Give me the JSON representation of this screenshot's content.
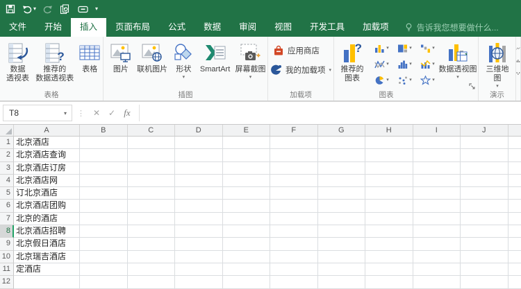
{
  "ui": {
    "caret": "▾",
    "dots": "⋮",
    "question_mark": "?"
  },
  "colors": {
    "brand_green": "#217346",
    "accent_green": "#21a366",
    "icon_blue": "#4472c4",
    "icon_dark_blue": "#2b579a",
    "icon_yellow": "#ffc000",
    "store_red": "#d24726",
    "ribbon_bg": "#f9fafa",
    "gridline": "#dadde0"
  },
  "quick_access": {
    "icons": [
      "save-icon",
      "undo-icon",
      "redo-icon",
      "document-refresh-icon",
      "touch-mode-icon",
      "customize-qat-caret-icon"
    ]
  },
  "tabs": [
    {
      "label": "文件",
      "active": false
    },
    {
      "label": "开始",
      "active": false
    },
    {
      "label": "插入",
      "active": true
    },
    {
      "label": "页面布局",
      "active": false
    },
    {
      "label": "公式",
      "active": false
    },
    {
      "label": "数据",
      "active": false
    },
    {
      "label": "审阅",
      "active": false
    },
    {
      "label": "视图",
      "active": false
    },
    {
      "label": "开发工具",
      "active": false
    },
    {
      "label": "加载项",
      "active": false
    }
  ],
  "tellme": {
    "label": "告诉我您想要做什么..."
  },
  "ribbon": {
    "group_tables": {
      "label": "表格",
      "pivot": "数据\n透视表",
      "recommended_pivot": "推荐的\n数据透视表",
      "table": "表格"
    },
    "group_illustrations": {
      "label": "插图",
      "pictures": "图片",
      "online_pictures": "联机图片",
      "shapes": "形状",
      "smartart": "SmartArt",
      "screenshot": "屏幕截图"
    },
    "group_addins": {
      "label": "加载项",
      "store": "应用商店",
      "my_addins": "我的加载项"
    },
    "group_charts": {
      "label": "图表",
      "recommended": "推荐的\n图表",
      "pivotchart": "数据透视图",
      "chart_type_icons": [
        "column-chart-icon",
        "hierarchy-chart-icon",
        "waterfall-chart-icon",
        "line-chart-icon",
        "histogram-chart-icon",
        "combo-chart-icon",
        "pie-chart-icon",
        "scatter-chart-icon",
        "radar-chart-icon"
      ]
    },
    "group_tours": {
      "label": "演示",
      "map3d": "三维地\n图"
    }
  },
  "formula_bar": {
    "name_box": "T8",
    "cancel": "✕",
    "enter": "✓",
    "fx": "fx",
    "input": ""
  },
  "sheet": {
    "columns": [
      "A",
      "B",
      "C",
      "D",
      "E",
      "F",
      "G",
      "H",
      "I",
      "J"
    ],
    "active_cell": "T8",
    "rows": [
      {
        "n": "1",
        "a": "北京酒店"
      },
      {
        "n": "2",
        "a": "北京酒店查询"
      },
      {
        "n": "3",
        "a": "北京酒店订房"
      },
      {
        "n": "4",
        "a": "北京酒店网"
      },
      {
        "n": "5",
        "a": "订北京酒店"
      },
      {
        "n": "6",
        "a": "北京酒店团购"
      },
      {
        "n": "7",
        "a": "北京的酒店"
      },
      {
        "n": "8",
        "a": "北京酒店招聘"
      },
      {
        "n": "9",
        "a": "北京假日酒店"
      },
      {
        "n": "10",
        "a": "北京瑞吉酒店"
      },
      {
        "n": "11",
        "a": "定酒店"
      },
      {
        "n": "12",
        "a": ""
      }
    ]
  }
}
